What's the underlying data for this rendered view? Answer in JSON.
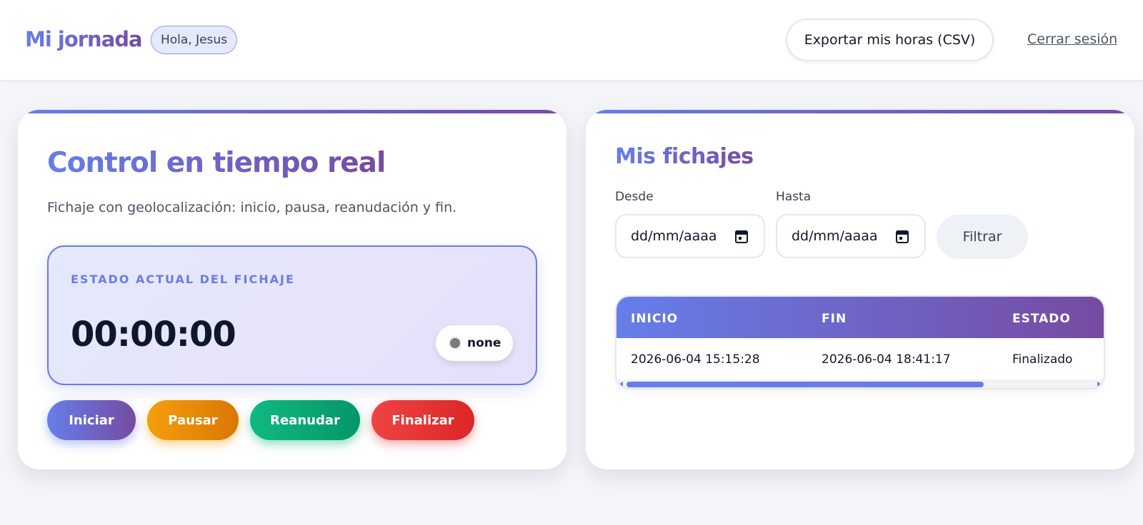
{
  "header": {
    "brand": "Mi jornada",
    "greeting": "Hola, Jesus",
    "export_label": "Exportar mis horas (CSV)",
    "logout_label": "Cerrar sesión"
  },
  "control": {
    "title": "Control en tiempo real",
    "subtitle": "Fichaje con geolocalización: inicio, pausa, reanudación y fin.",
    "status_label": "ESTADO ACTUAL DEL FICHAJE",
    "timer": "00:00:00",
    "status_value": "none",
    "actions": {
      "start": "Iniciar",
      "pause": "Pausar",
      "resume": "Reanudar",
      "finish": "Finalizar"
    }
  },
  "records": {
    "title": "Mis fichajes",
    "from_label": "Desde",
    "to_label": "Hasta",
    "from_placeholder": "dd/mm/aaaa",
    "to_placeholder": "dd/mm/aaaa",
    "filter_label": "Filtrar",
    "columns": [
      "INICIO",
      "FIN",
      "ESTADO"
    ],
    "rows": [
      [
        "2026-06-04 15:15:28",
        "2026-06-04 18:41:17",
        "Finalizado"
      ]
    ]
  },
  "icons": {
    "calendar": "calendar-icon",
    "status_dot": "status-dot-icon"
  },
  "colors": {
    "accent_start": "#667eea",
    "accent_end": "#764ba2",
    "pause": "#f59e0b",
    "resume": "#10b981",
    "finish": "#ef4444"
  }
}
